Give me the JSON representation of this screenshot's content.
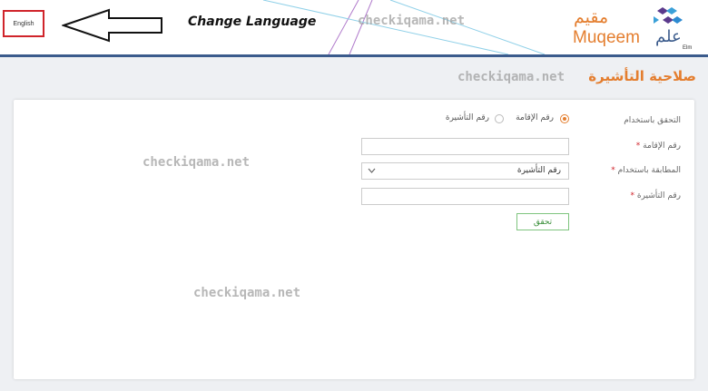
{
  "header": {
    "language_button": "English",
    "annotation_text": "Change Language",
    "brand_arabic": "مقيم",
    "brand_english": "Muqeem",
    "elm_arabic": "علم",
    "elm_english": "Elm"
  },
  "watermark": "checkiqama.net",
  "page": {
    "title": "صلاحية التأشيرة"
  },
  "form": {
    "verify_using_label": "التحقق باستخدام",
    "radio_options": [
      {
        "label": "رقم الإقامة",
        "selected": true
      },
      {
        "label": "رقم التأشيرة",
        "selected": false
      }
    ],
    "iqama_label": "رقم الإقامة",
    "iqama_value": "",
    "match_label": "المطابقة باستخدام",
    "match_selected": "رقم التأشيرة",
    "visa_label": "رقم التأشيرة",
    "visa_value": "",
    "required_mark": "*",
    "submit_label": "تحقق"
  },
  "colors": {
    "accent": "#e47e2f",
    "header_line": "#3b5b8c",
    "submit_border": "#7ec47e",
    "lang_border": "#d0242b"
  }
}
